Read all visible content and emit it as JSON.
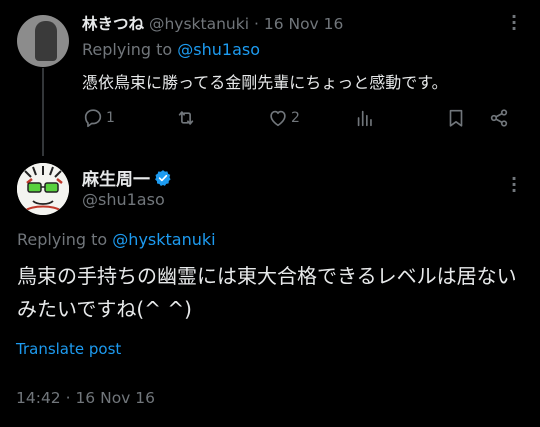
{
  "reply_tweet": {
    "author_name": "林きつね",
    "handle": "@hysktanuki",
    "separator": "·",
    "date": "16 Nov 16",
    "replying_prefix": "Replying to",
    "replying_handle": "@shu1aso",
    "text": "憑依鳥束に勝ってる金剛先輩にちょっと感動です。",
    "reply_count": "1",
    "like_count": "2"
  },
  "main_tweet": {
    "author_name": "麻生周一",
    "handle": "@shu1aso",
    "replying_prefix": "Replying to",
    "replying_handle": "@hysktanuki",
    "text": "鳥束の手持ちの幽霊には東大合格できるレベルは居ないみたいですね(^ ^)",
    "translate_label": "Translate post",
    "timestamp": "14:42 · 16 Nov 16",
    "verified_color": "#1d9bf0"
  },
  "icons": {
    "more": "more-dots-icon",
    "reply": "reply-bubble-icon",
    "retweet": "retweet-icon",
    "like": "heart-icon",
    "views": "views-bars-icon",
    "bookmark": "bookmark-icon",
    "share": "share-icon",
    "verified": "verified-badge-icon"
  },
  "colors": {
    "background": "#000000",
    "text": "#e7e9ea",
    "muted": "#71767b",
    "link": "#1d9bf0"
  }
}
